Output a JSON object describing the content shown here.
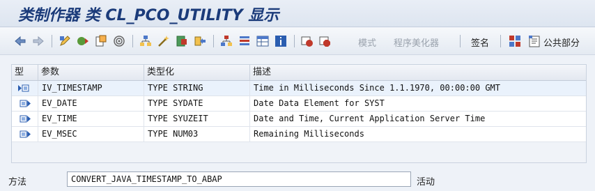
{
  "window": {
    "title": "类制作器 类 CL_PCO_UTILITY 显示"
  },
  "toolbar": {
    "back_icon": "arrow-left-icon",
    "forward_icon": "arrow-right-icon",
    "mode_label": "模式",
    "pretty_printer_label": "程序美化器",
    "signature_label": "签名",
    "public_section_label": "公共部分"
  },
  "table": {
    "columns": [
      "型",
      "参数",
      "类型化",
      "描述"
    ],
    "rows": [
      {
        "type_icon": "importing-param-icon",
        "param": "IV_TIMESTAMP",
        "typing": "TYPE STRING",
        "description": "Time in Milliseconds Since 1.1.1970, 00:00:00 GMT"
      },
      {
        "type_icon": "exporting-param-icon",
        "param": "EV_DATE",
        "typing": "TYPE SYDATE",
        "description": "Date Data Element for SYST"
      },
      {
        "type_icon": "exporting-param-icon",
        "param": "EV_TIME",
        "typing": "TYPE SYUZEIT",
        "description": "Date and Time, Current Application Server Time"
      },
      {
        "type_icon": "exporting-param-icon",
        "param": "EV_MSEC",
        "typing": "TYPE NUM03",
        "description": "Remaining Milliseconds"
      }
    ]
  },
  "status": {
    "method_label": "方法",
    "method_value": "CONVERT_JAVA_TIMESTAMP_TO_ABAP",
    "state_label": "活动"
  },
  "colors": {
    "title": "#1b3b7a",
    "accent_blue": "#2a5db0",
    "accent_red": "#c0392b"
  }
}
